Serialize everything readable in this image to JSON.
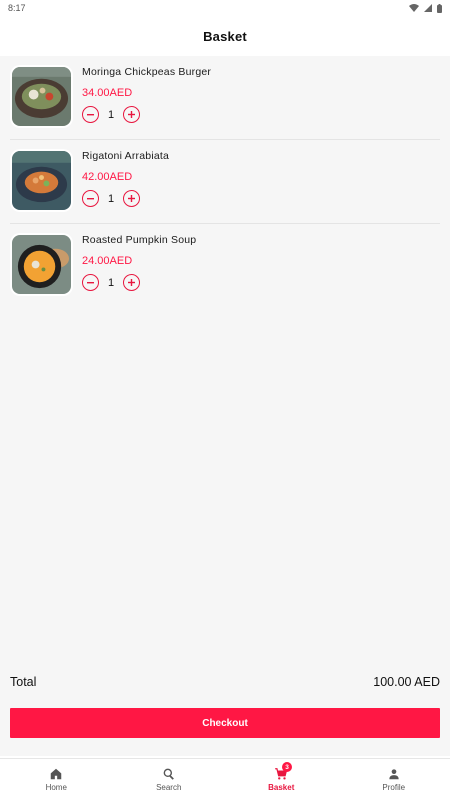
{
  "status_bar": {
    "time": "8:17"
  },
  "header": {
    "title": "Basket"
  },
  "basket": {
    "items": [
      {
        "name": "Moringa Chickpeas Burger",
        "price": "34.00AED",
        "quantity": "1"
      },
      {
        "name": "Rigatoni Arrabiata",
        "price": "42.00AED",
        "quantity": "1"
      },
      {
        "name": "Roasted Pumpkin Soup",
        "price": "24.00AED",
        "quantity": "1"
      }
    ]
  },
  "summary": {
    "total_label": "Total",
    "total_value": "100.00 AED"
  },
  "checkout": {
    "label": "Checkout"
  },
  "bottom_nav": {
    "items": [
      {
        "label": "Home",
        "icon": "home-icon"
      },
      {
        "label": "Search",
        "icon": "search-icon"
      },
      {
        "label": "Basket",
        "icon": "cart-icon",
        "badge": "3",
        "active": true
      },
      {
        "label": "Profile",
        "icon": "person-icon"
      }
    ]
  },
  "colors": {
    "accent": "#ff1744",
    "background": "#f6f6f6"
  }
}
